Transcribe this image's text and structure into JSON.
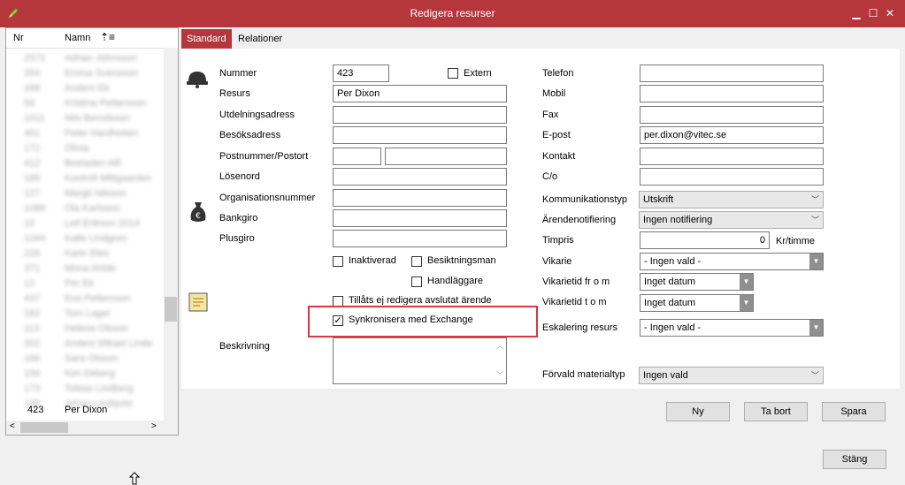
{
  "window": {
    "title": "Redigera resurser"
  },
  "list": {
    "columns": {
      "nr": "Nr",
      "name": "Namn"
    },
    "rows": [
      {
        "nr": "2571",
        "name": "Adrian Johnsson"
      },
      {
        "nr": "354",
        "name": "Emma Svensson"
      },
      {
        "nr": "188",
        "name": "Anders Ek"
      },
      {
        "nr": "56",
        "name": "Kristina Pettersson"
      },
      {
        "nr": "1011",
        "name": "Nils Berndsson"
      },
      {
        "nr": "401",
        "name": "Peter Hardhotten"
      },
      {
        "nr": "172",
        "name": "Olivia"
      },
      {
        "nr": "412",
        "name": "Bostaden AB"
      },
      {
        "nr": "186",
        "name": "Kontroll Mittgaarden"
      },
      {
        "nr": "127",
        "name": "Margit Nilsson"
      },
      {
        "nr": "1088",
        "name": "Ola Karlsson"
      },
      {
        "nr": "10",
        "name": "Leif Erikson 2014"
      },
      {
        "nr": "1344",
        "name": "Kalle Lindgren"
      },
      {
        "nr": "226",
        "name": "Karin Eles"
      },
      {
        "nr": "371",
        "name": "Mona Ahlde"
      },
      {
        "nr": "12",
        "name": "Per Ek"
      },
      {
        "nr": "437",
        "name": "Eva Pettersson"
      },
      {
        "nr": "182",
        "name": "Tom Lager"
      },
      {
        "nr": "113",
        "name": "Helena Olsson"
      },
      {
        "nr": "302",
        "name": "Anders Mikael Linde"
      },
      {
        "nr": "166",
        "name": "Sara Olsson"
      },
      {
        "nr": "156",
        "name": "Kim Ekberg"
      },
      {
        "nr": "173",
        "name": "Tobias Lindberg"
      },
      {
        "nr": "145",
        "name": "Johan Lindqvist"
      }
    ],
    "selected": {
      "nr": "423",
      "name": "Per Dixon"
    }
  },
  "tabs": [
    "Standard",
    "Relationer"
  ],
  "form": {
    "labels": {
      "nummer": "Nummer",
      "resurs": "Resurs",
      "utdelningsadress": "Utdelningsadress",
      "besoksadress": "Besöksadress",
      "postnummer": "Postnummer/Postort",
      "losenord": "Lösenord",
      "organisationsnummer": "Organisationsnummer",
      "bankgiro": "Bankgiro",
      "plusgiro": "Plusgiro",
      "beskrivning": "Beskrivning",
      "telefon": "Telefon",
      "mobil": "Mobil",
      "fax": "Fax",
      "epost": "E-post",
      "kontakt": "Kontakt",
      "co": "C/o",
      "kommunikationstyp": "Kommunikationstyp",
      "arendenotifiering": "Ärendenotifiering",
      "timpris": "Timpris",
      "timpris_unit": "Kr/timme",
      "vikarie": "Vikarie",
      "vikarietid_from": "Vikarietid fr o m",
      "vikarietid_tom": "Vikarietid t o m",
      "eskalering": "Eskalering resurs",
      "forvald_materialtyp": "Förvald materialtyp"
    },
    "values": {
      "nummer": "423",
      "resurs": "Per Dixon",
      "epost": "per.dixon@vitec.se",
      "kommunikationstyp": "Utskrift",
      "arendenotifiering": "Ingen notifiering",
      "timpris": "0",
      "vikarie": "- Ingen vald -",
      "vikarietid_from": "Inget datum",
      "vikarietid_tom": "Inget datum",
      "eskalering": "- Ingen vald -",
      "forvald_materialtyp": "Ingen vald"
    },
    "checkboxes": {
      "extern": "Extern",
      "inaktiverad": "Inaktiverad",
      "besiktningsman": "Besiktningsman",
      "handlaggare": "Handläggare",
      "tillats": "Tillåts ej redigera avslutat ärende",
      "synk": "Synkronisera med Exchange"
    }
  },
  "buttons": {
    "ny": "Ny",
    "ta_bort": "Ta bort",
    "spara": "Spara",
    "stang": "Stäng"
  },
  "colors": {
    "titlebar": "#b5373c",
    "highlight": "#d9363e"
  }
}
